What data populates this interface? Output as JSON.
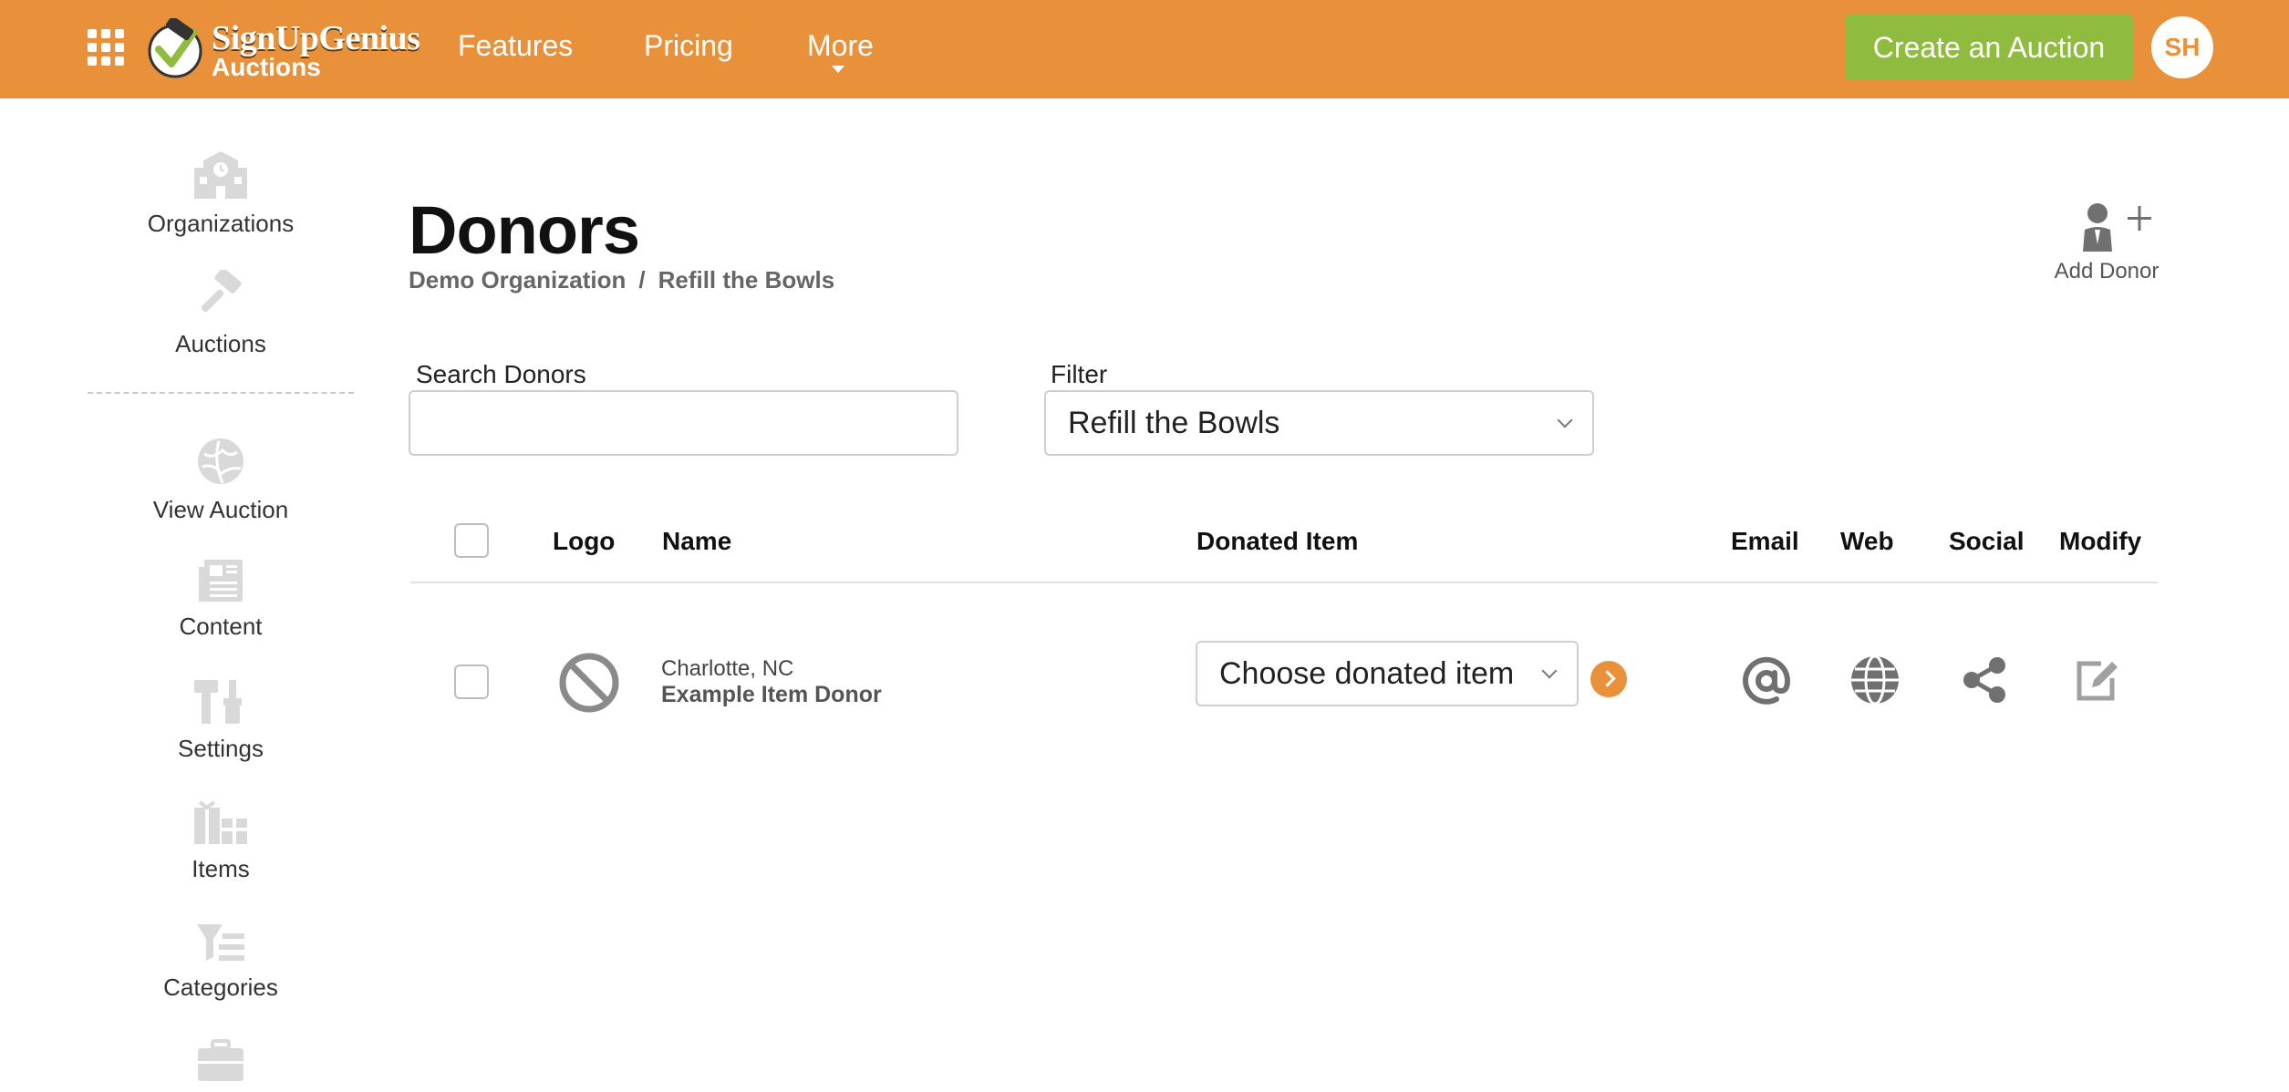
{
  "header": {
    "brand_line1": "SignUpGenius",
    "brand_line2": "Auctions",
    "nav": [
      {
        "label": "Features"
      },
      {
        "label": "Pricing"
      },
      {
        "label": "More"
      }
    ],
    "cta_label": "Create an Auction",
    "avatar_initials": "SH",
    "brand_color": "#e8913a",
    "cta_color": "#8fbc3f"
  },
  "sidebar": {
    "items": [
      {
        "label": "Organizations",
        "icon": "school-building-icon"
      },
      {
        "label": "Auctions",
        "icon": "gavel-icon"
      },
      {
        "label": "View Auction",
        "icon": "globe-icon"
      },
      {
        "label": "Content",
        "icon": "newspaper-icon"
      },
      {
        "label": "Settings",
        "icon": "tools-icon"
      },
      {
        "label": "Items",
        "icon": "gifts-icon"
      },
      {
        "label": "Categories",
        "icon": "filter-list-icon"
      },
      {
        "label": "",
        "icon": "briefcase-icon"
      }
    ]
  },
  "main": {
    "title": "Donors",
    "breadcrumb": [
      "Demo Organization",
      "Refill the Bowls"
    ],
    "breadcrumb_sep": "/",
    "add_donor_label": "Add Donor",
    "search": {
      "label": "Search Donors",
      "value": "",
      "placeholder": ""
    },
    "filter": {
      "label": "Filter",
      "selected": "Refill the Bowls"
    },
    "table": {
      "columns": [
        "Logo",
        "Name",
        "Donated Item",
        "Email",
        "Web",
        "Social",
        "Modify"
      ],
      "rows": [
        {
          "location": "Charlotte, NC",
          "name": "Example Item Donor",
          "logo": "no-logo-icon",
          "donated_item_select": "Choose donated item"
        }
      ]
    }
  }
}
